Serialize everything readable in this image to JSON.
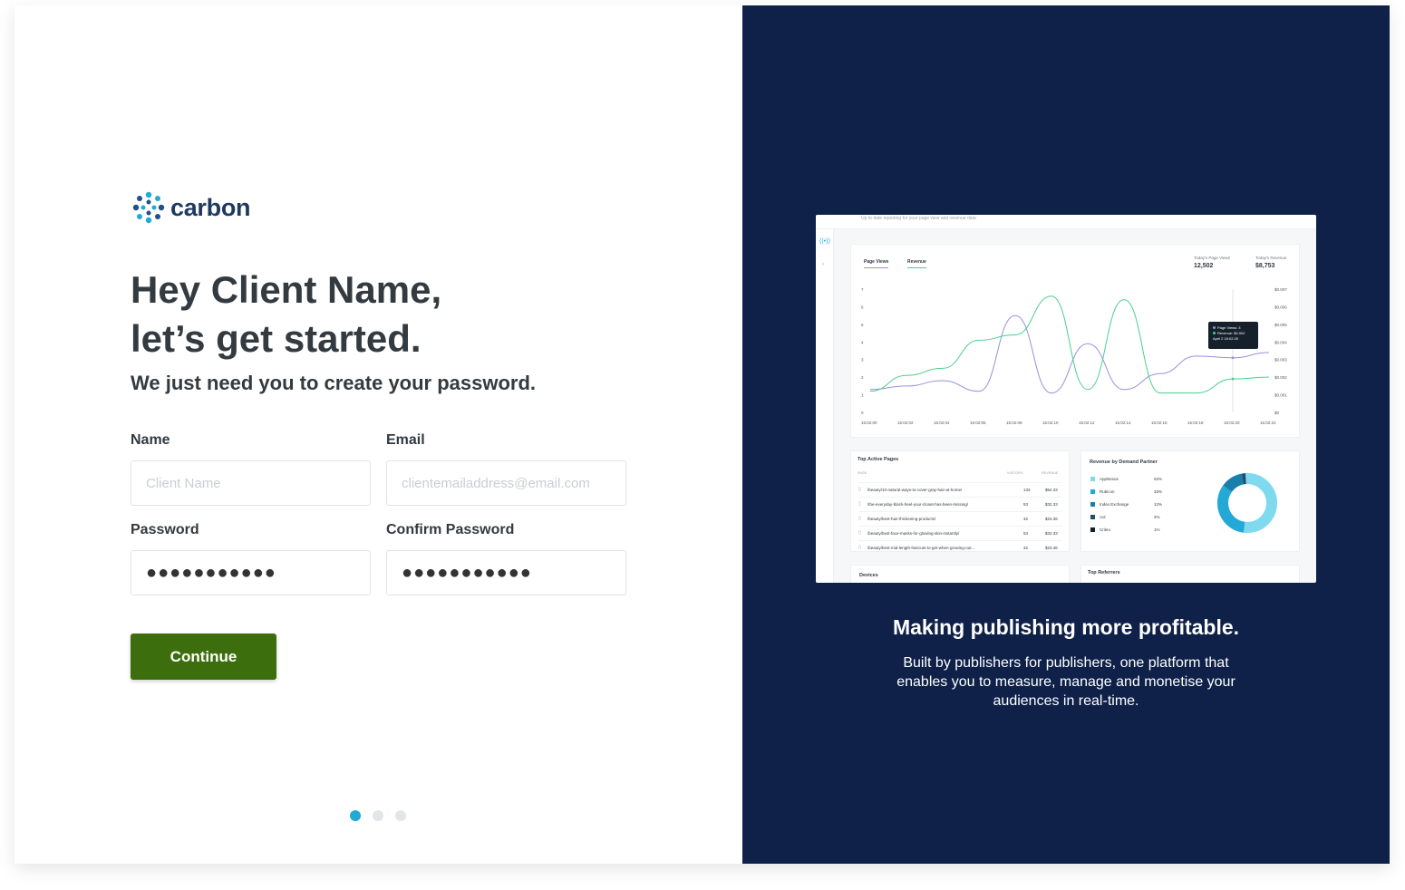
{
  "brand": {
    "name": "carbon",
    "logo_colors": [
      "#1f4f8c",
      "#22a9d6"
    ]
  },
  "form": {
    "headline_line1": "Hey Client Name,",
    "headline_line2": "let’s get started.",
    "subhead": "We just need you to create your password.",
    "name_label": "Name",
    "name_placeholder": "Client Name",
    "email_label": "Email",
    "email_placeholder": "clientemailaddress@email.com",
    "password_label": "Password",
    "password_value": "●●●●●●●●●●●",
    "confirm_label": "Confirm Password",
    "confirm_value": "●●●●●●●●●●●",
    "continue_label": "Continue",
    "button_color": "#3d6e0e"
  },
  "pagination": {
    "total": 3,
    "active": 1,
    "active_color": "#22a9d6"
  },
  "promo": {
    "title": "Making publishing more profitable.",
    "body": "Built by publishers for publishers, one platform that enables you to measure, manage and monetise your audiences in real-time.",
    "background": "#0f2149"
  },
  "dashboard": {
    "top_text": "Up to date reporting for your page view and revenue data",
    "tabs": [
      "Page Views",
      "Revenue"
    ],
    "stats": [
      {
        "label": "Today's Page Views",
        "value": "12,502"
      },
      {
        "label": "Today's Revenue",
        "value": "$8,753"
      }
    ],
    "tooltip": {
      "line1": "Page Views: 3",
      "line2": "Revenue: $0.002",
      "line3": "April 2 15:02:20"
    },
    "top_pages_title": "Top Active Pages",
    "top_pages_cols": [
      "PAGE",
      "VISITORS",
      "REVENUE"
    ],
    "top_pages": [
      {
        "page": "/beauty/10-natural-ways-to-cover-gray-hair-at-home/",
        "visitors": "133",
        "revenue": "$54.33"
      },
      {
        "page": "/the-everyday-black-heel-your-closet-has-been-missing/",
        "visitors": "53",
        "revenue": "$32.33"
      },
      {
        "page": "/beauty/best-hair-thickening-products/",
        "visitors": "32",
        "revenue": "$23.36"
      },
      {
        "page": "/beauty/best-face-masks-for-glowing-skin-instantly/",
        "visitors": "53",
        "revenue": "$32.33"
      },
      {
        "page": "/beauty/best-mid-length-haircuts-to-get-when-growing-out...",
        "visitors": "32",
        "revenue": "$23.36"
      }
    ],
    "partners_title": "Revenue by Demand Partner",
    "partners": [
      {
        "name": "AppNexus",
        "pct": "52%",
        "color": "#7fdaf0"
      },
      {
        "name": "Rubicon",
        "pct": "33%",
        "color": "#22a9d6"
      },
      {
        "name": "Index Exchange",
        "pct": "12%",
        "color": "#1a7fa8"
      },
      {
        "name": "Aol",
        "pct": "2%",
        "color": "#1f4f6c"
      },
      {
        "name": "Criteo",
        "pct": "1%",
        "color": "#15202b"
      }
    ],
    "devices_title": "Devices",
    "referrers_title": "Top Referrers",
    "chart_data": {
      "type": "line",
      "x": [
        "15:02:00",
        "15:02:02",
        "15:02:04",
        "15:02:05",
        "15:02:06",
        "15:02:10",
        "15:02:12",
        "15:02:14",
        "15:02:16",
        "15:02:18",
        "15:02:20",
        "15:02:22"
      ],
      "y_left_ticks": [
        "0",
        "1",
        "2",
        "3",
        "4",
        "5",
        "6",
        "7"
      ],
      "y_right_ticks": [
        "$0",
        "$0.001",
        "$0.002",
        "$0.003",
        "$0.004",
        "$0.005",
        "$0.006",
        "$0.007"
      ],
      "series": [
        {
          "name": "Page Views",
          "color": "#9b8fd8",
          "values": [
            1.3,
            1.5,
            1.8,
            1.2,
            5.5,
            1.1,
            3.9,
            1.3,
            2.2,
            3.2,
            3.1,
            3.4
          ]
        },
        {
          "name": "Revenue",
          "color": "#48d18f",
          "values": [
            0.0012,
            0.0021,
            0.0025,
            0.0041,
            0.0044,
            0.0066,
            0.0013,
            0.0064,
            0.0011,
            0.0011,
            0.0019,
            0.002
          ]
        }
      ]
    }
  }
}
